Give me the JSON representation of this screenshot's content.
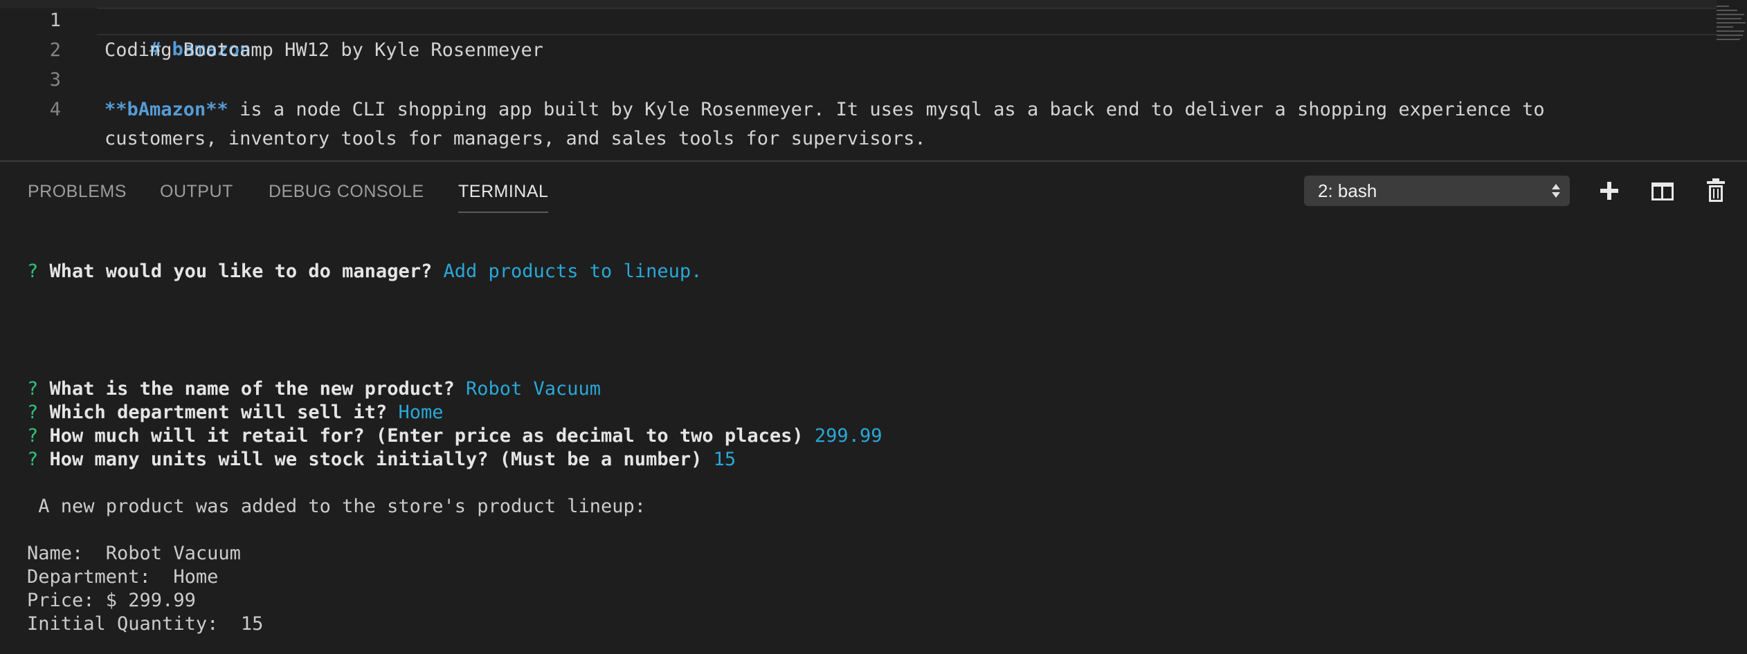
{
  "editor": {
    "lines": [
      {
        "number": "1",
        "heading": "# bamazon"
      },
      {
        "number": "2",
        "text": "Coding Bootcamp HW12 by Kyle Rosenmeyer"
      },
      {
        "number": "3",
        "text": ""
      },
      {
        "number": "4",
        "bold": "**bAmazon**",
        "text": " is a node CLI shopping app built by Kyle Rosenmeyer. It uses mysql as a back end to deliver a shopping experience to",
        "continuation": "customers, inventory tools for managers, and sales tools for supervisors."
      }
    ]
  },
  "panel": {
    "tabs": [
      "PROBLEMS",
      "OUTPUT",
      "DEBUG CONSOLE",
      "TERMINAL"
    ],
    "active_tab": "TERMINAL",
    "terminal_select": "2: bash",
    "actions": [
      "plus-icon",
      "split-icon",
      "trash-icon"
    ]
  },
  "terminal": {
    "prompt_symbol": "?",
    "q1": {
      "question": "What would you like to do manager?",
      "answer": "Add products to lineup."
    },
    "q2": {
      "question": "What is the name of the new product?",
      "answer": "Robot Vacuum"
    },
    "q3": {
      "question": "Which department will sell it?",
      "answer": "Home"
    },
    "q4": {
      "question": "How much will it retail for? (Enter price as decimal to two places)",
      "answer": "299.99"
    },
    "q5": {
      "question": "How many units will we stock initially? (Must be a number)",
      "answer": "15"
    },
    "confirmation": " A new product was added to the store's product lineup:",
    "details": [
      "Name:  Robot Vacuum",
      "Department:  Home",
      "Price: $ 299.99",
      "Initial Quantity:  15"
    ]
  },
  "colors": {
    "background": "#1e1e1e",
    "prompt": "#2ec27e",
    "answer": "#29a8d8",
    "markdown": "#569cd6"
  }
}
